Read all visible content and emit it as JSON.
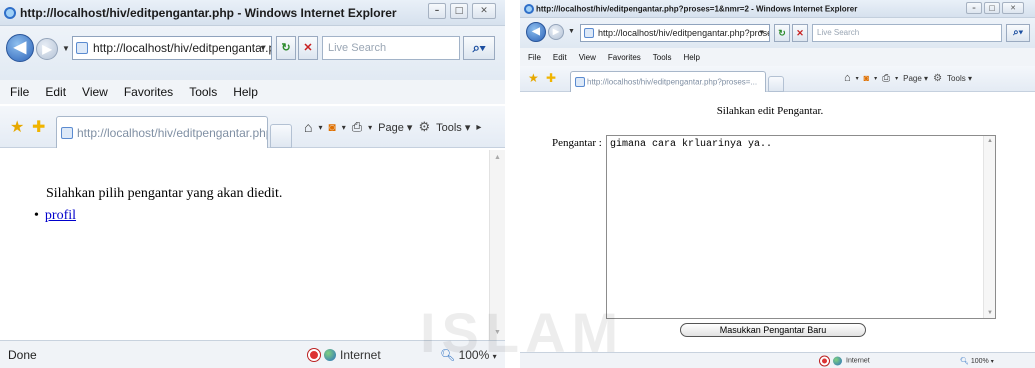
{
  "windowA": {
    "title": "http://localhost/hiv/editpengantar.php - Windows Internet Explorer",
    "address": "http://localhost/hiv/editpengantar.php",
    "search_placeholder": "Live Search",
    "menu": [
      "File",
      "Edit",
      "View",
      "Favorites",
      "Tools",
      "Help"
    ],
    "tab_title": "http://localhost/hiv/editpengantar.php",
    "toolbar": {
      "page_label": "Page",
      "tools_label": "Tools"
    },
    "content": {
      "instruction": "Silahkan pilih pengantar yang akan diedit.",
      "items": [
        "profil"
      ]
    },
    "status": {
      "text": "Done",
      "zone": "Internet",
      "zoom": "100%"
    }
  },
  "windowB": {
    "title": "http://localhost/hiv/editpengantar.php?proses=1&nmr=2 - Windows Internet Explorer",
    "address": "http://localhost/hiv/editpengantar.php?proses",
    "search_placeholder": "Live Search",
    "menu": [
      "File",
      "Edit",
      "View",
      "Favorites",
      "Tools",
      "Help"
    ],
    "tab_title": "http://localhost/hiv/editpengantar.php?proses=...",
    "toolbar": {
      "page_label": "Page",
      "tools_label": "Tools"
    },
    "form": {
      "heading": "Silahkan edit Pengantar.",
      "field_label": "Pengantar :",
      "field_value": "gimana cara krluarinya ya..",
      "submit_label": "Masukkan Pengantar Baru"
    },
    "status": {
      "zone": "Internet",
      "zoom": "100%"
    }
  },
  "watermark": "ISLAM"
}
